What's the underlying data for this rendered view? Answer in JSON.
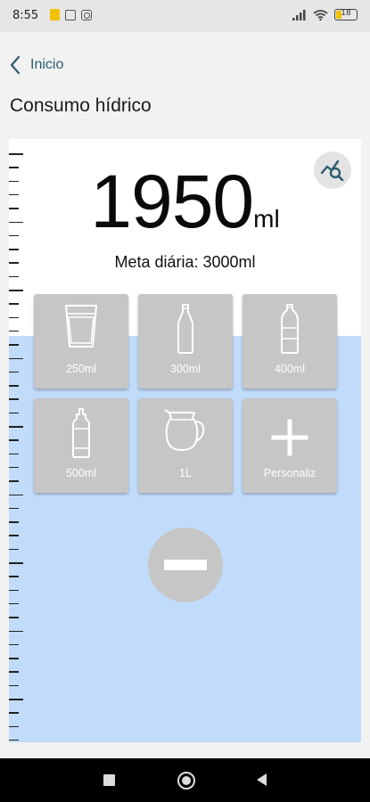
{
  "status_bar": {
    "time": "8:55",
    "battery_level": "18",
    "icons": [
      "notification-icon",
      "screen-icon",
      "instagram-icon",
      "signal-icon",
      "wifi-icon",
      "battery-icon"
    ]
  },
  "header": {
    "back_label": "Inicio",
    "title": "Consumo hídrico"
  },
  "summary": {
    "amount": "1950",
    "unit": "ml",
    "goal_text": "Meta diária: 3000ml",
    "fill_fraction": 0.65
  },
  "drinks": [
    {
      "label": "250ml",
      "icon": "glass-icon"
    },
    {
      "label": "300ml",
      "icon": "small-bottle-icon"
    },
    {
      "label": "400ml",
      "icon": "bottle-icon"
    },
    {
      "label": "500ml",
      "icon": "sports-bottle-icon"
    },
    {
      "label": "1L",
      "icon": "jug-icon"
    },
    {
      "label": "Personaliz",
      "icon": "plus-icon"
    }
  ],
  "colors": {
    "water": "#c1dcfb",
    "tile": "#c6c6c6",
    "accent": "#2b5c6e"
  }
}
